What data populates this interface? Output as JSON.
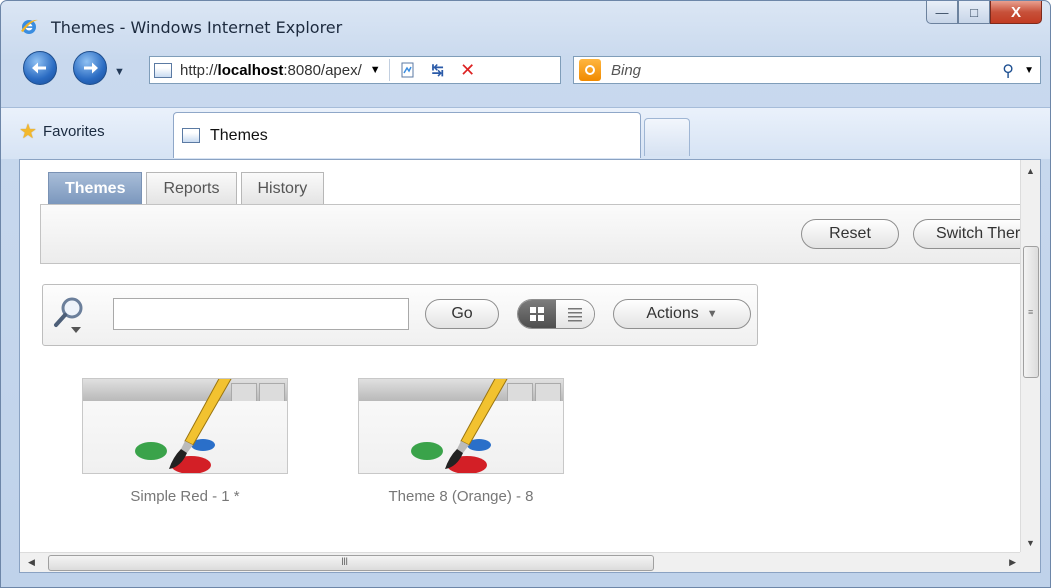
{
  "window": {
    "title": "Themes - Windows Internet Explorer",
    "min_label": "—",
    "max_label": "□",
    "close_label": "X"
  },
  "navbar": {
    "url_prefix": "http://",
    "url_host": "localhost",
    "url_rest": ":8080/apex/",
    "search_placeholder": "Bing"
  },
  "favbar": {
    "favorites_label": "Favorites",
    "tab_label": "Themes"
  },
  "page": {
    "tabs": [
      {
        "label": "Themes",
        "active": true
      },
      {
        "label": "Reports",
        "active": false
      },
      {
        "label": "History",
        "active": false
      }
    ],
    "reset_label": "Reset",
    "switch_label": "Switch Ther",
    "go_label": "Go",
    "actions_label": "Actions",
    "search_value": "",
    "themes": [
      {
        "name": "Simple Red - 1 *"
      },
      {
        "name": "Theme 8 (Orange) - 8"
      }
    ]
  },
  "icons": {
    "browser": "ie-logo-icon",
    "back": "back-arrow-icon",
    "forward": "forward-arrow-icon",
    "search": "magnifier-icon",
    "favorites": "star-icon"
  },
  "colors": {
    "active_tab": "#7b97bd",
    "close_button": "#c23b22",
    "bing_brand": "#f08a00"
  }
}
